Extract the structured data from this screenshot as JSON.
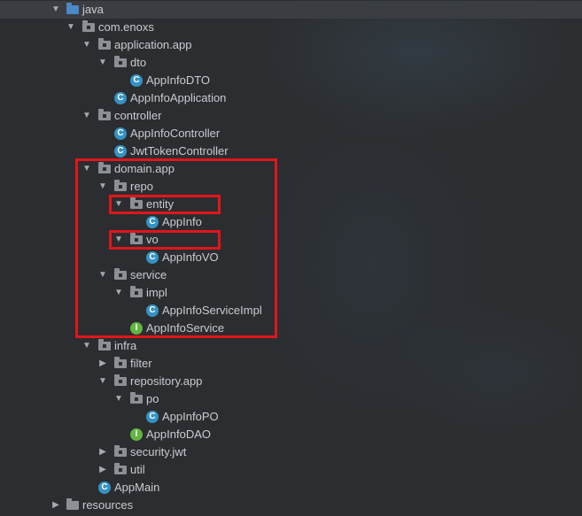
{
  "tree": {
    "java": "java",
    "com_enoxs": "com.enoxs",
    "application_app": "application.app",
    "dto": "dto",
    "appinfo_dto": "AppInfoDTO",
    "appinfo_application": "AppInfoApplication",
    "controller": "controller",
    "appinfo_controller": "AppInfoController",
    "jwt_token_controller": "JwtTokenController",
    "domain_app": "domain.app",
    "repo": "repo",
    "entity": "entity",
    "appinfo": "AppInfo",
    "vo": "vo",
    "appinfo_vo": "AppInfoVO",
    "service": "service",
    "impl": "impl",
    "appinfo_service_impl": "AppInfoServiceImpl",
    "appinfo_service": "AppInfoService",
    "infra": "infra",
    "filter": "filter",
    "repository_app": "repository.app",
    "po": "po",
    "appinfo_po": "AppInfoPO",
    "appinfo_dao": "AppInfoDAO",
    "security_jwt": "security.jwt",
    "util": "util",
    "appmain": "AppMain",
    "resources": "resources"
  },
  "icons": {
    "class_letter": "C",
    "interface_letter": "I"
  },
  "colors": {
    "highlight": "#e0161b",
    "class_icon": "#3592c4",
    "interface_icon": "#62b543",
    "java_folder": "#4a88c7"
  }
}
